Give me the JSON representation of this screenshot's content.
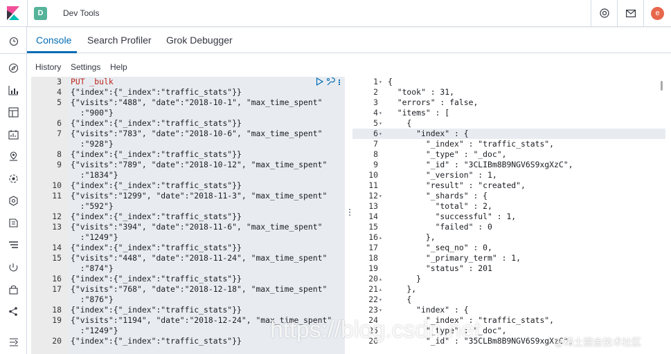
{
  "header": {
    "space_initial": "D",
    "app_title": "Dev Tools",
    "avatar_initial": "e"
  },
  "tabs": [
    {
      "label": "Console"
    },
    {
      "label": "Search Profiler"
    },
    {
      "label": "Grok Debugger"
    }
  ],
  "menu": [
    {
      "label": "History"
    },
    {
      "label": "Settings"
    },
    {
      "label": "Help"
    }
  ],
  "editor_lines": [
    {
      "n": "3",
      "text": "PUT _bulk",
      "method": true
    },
    {
      "n": "4",
      "text": "{\"index\":{\"_index\":\"traffic_stats\"}}"
    },
    {
      "n": "5",
      "text": "{\"visits\":\"488\", \"date\":\"2018-10-1\", \"max_time_spent\""
    },
    {
      "n": "",
      "text": "  :\"900\"}"
    },
    {
      "n": "6",
      "text": "{\"index\":{\"_index\":\"traffic_stats\"}}"
    },
    {
      "n": "7",
      "text": "{\"visits\":\"783\", \"date\":\"2018-10-6\", \"max_time_spent\""
    },
    {
      "n": "",
      "text": "  :\"928\"}"
    },
    {
      "n": "8",
      "text": "{\"index\":{\"_index\":\"traffic_stats\"}}"
    },
    {
      "n": "9",
      "text": "{\"visits\":\"789\", \"date\":\"2018-10-12\", \"max_time_spent\""
    },
    {
      "n": "",
      "text": "  :\"1834\"}"
    },
    {
      "n": "10",
      "text": "{\"index\":{\"_index\":\"traffic_stats\"}}"
    },
    {
      "n": "11",
      "text": "{\"visits\":\"1299\", \"date\":\"2018-11-3\", \"max_time_spent\""
    },
    {
      "n": "",
      "text": "  :\"592\"}"
    },
    {
      "n": "12",
      "text": "{\"index\":{\"_index\":\"traffic_stats\"}}"
    },
    {
      "n": "13",
      "text": "{\"visits\":\"394\", \"date\":\"2018-11-6\", \"max_time_spent\""
    },
    {
      "n": "",
      "text": "  :\"1249\"}"
    },
    {
      "n": "14",
      "text": "{\"index\":{\"_index\":\"traffic_stats\"}}"
    },
    {
      "n": "15",
      "text": "{\"visits\":\"448\", \"date\":\"2018-11-24\", \"max_time_spent\""
    },
    {
      "n": "",
      "text": "  :\"874\"}"
    },
    {
      "n": "16",
      "text": "{\"index\":{\"_index\":\"traffic_stats\"}}"
    },
    {
      "n": "17",
      "text": "{\"visits\":\"768\", \"date\":\"2018-12-18\", \"max_time_spent\""
    },
    {
      "n": "",
      "text": "  :\"876\"}"
    },
    {
      "n": "18",
      "text": "{\"index\":{\"_index\":\"traffic_stats\"}}"
    },
    {
      "n": "19",
      "text": "{\"visits\":\"1194\", \"date\":\"2018-12-24\", \"max_time_spent\""
    },
    {
      "n": "",
      "text": "  :\"1249\"}"
    },
    {
      "n": "20",
      "text": "{\"index\":{\"_index\":\"traffic_stats\"}}"
    }
  ],
  "output_lines": [
    {
      "n": "1",
      "fold": "▾",
      "text": "{"
    },
    {
      "n": "2",
      "fold": "",
      "text": "  \"took\" : 31,"
    },
    {
      "n": "3",
      "fold": "",
      "text": "  \"errors\" : false,"
    },
    {
      "n": "4",
      "fold": "▾",
      "text": "  \"items\" : ["
    },
    {
      "n": "5",
      "fold": "▾",
      "text": "    {"
    },
    {
      "n": "6",
      "fold": "▾",
      "text": "      \"index\" : {",
      "highlight": true
    },
    {
      "n": "7",
      "fold": "",
      "text": "        \"_index\" : \"traffic_stats\","
    },
    {
      "n": "8",
      "fold": "",
      "text": "        \"_type\" : \"_doc\","
    },
    {
      "n": "9",
      "fold": "",
      "text": "        \"_id\" : \"3CLIBm8B9NGV6S9xgXzC\","
    },
    {
      "n": "10",
      "fold": "",
      "text": "        \"_version\" : 1,"
    },
    {
      "n": "11",
      "fold": "",
      "text": "        \"result\" : \"created\","
    },
    {
      "n": "12",
      "fold": "▾",
      "text": "        \"_shards\" : {"
    },
    {
      "n": "13",
      "fold": "",
      "text": "          \"total\" : 2,"
    },
    {
      "n": "14",
      "fold": "",
      "text": "          \"successful\" : 1,"
    },
    {
      "n": "15",
      "fold": "",
      "text": "          \"failed\" : 0"
    },
    {
      "n": "16",
      "fold": "▴",
      "text": "        },"
    },
    {
      "n": "17",
      "fold": "",
      "text": "        \"_seq_no\" : 0,"
    },
    {
      "n": "18",
      "fold": "",
      "text": "        \"_primary_term\" : 1,"
    },
    {
      "n": "19",
      "fold": "",
      "text": "        \"status\" : 201"
    },
    {
      "n": "20",
      "fold": "▴",
      "text": "      }"
    },
    {
      "n": "21",
      "fold": "▴",
      "text": "    },"
    },
    {
      "n": "22",
      "fold": "▾",
      "text": "    {"
    },
    {
      "n": "23",
      "fold": "▾",
      "text": "      \"index\" : {"
    },
    {
      "n": "24",
      "fold": "",
      "text": "        \"_index\" : \"traffic_stats\","
    },
    {
      "n": "25",
      "fold": "",
      "text": "        \"_type\" : \"_doc\","
    },
    {
      "n": "26",
      "fold": "",
      "text": "        \"_id\" : \"35CLBm8B9NGV6S9xgXzC\","
    }
  ],
  "watermark": "https://blog.csdn.net",
  "watermark_brand": "@稀土掘金技术社区",
  "colors": {
    "accent": "#006bb4",
    "space_badge": "#54b399",
    "avatar": "#e7664c"
  }
}
